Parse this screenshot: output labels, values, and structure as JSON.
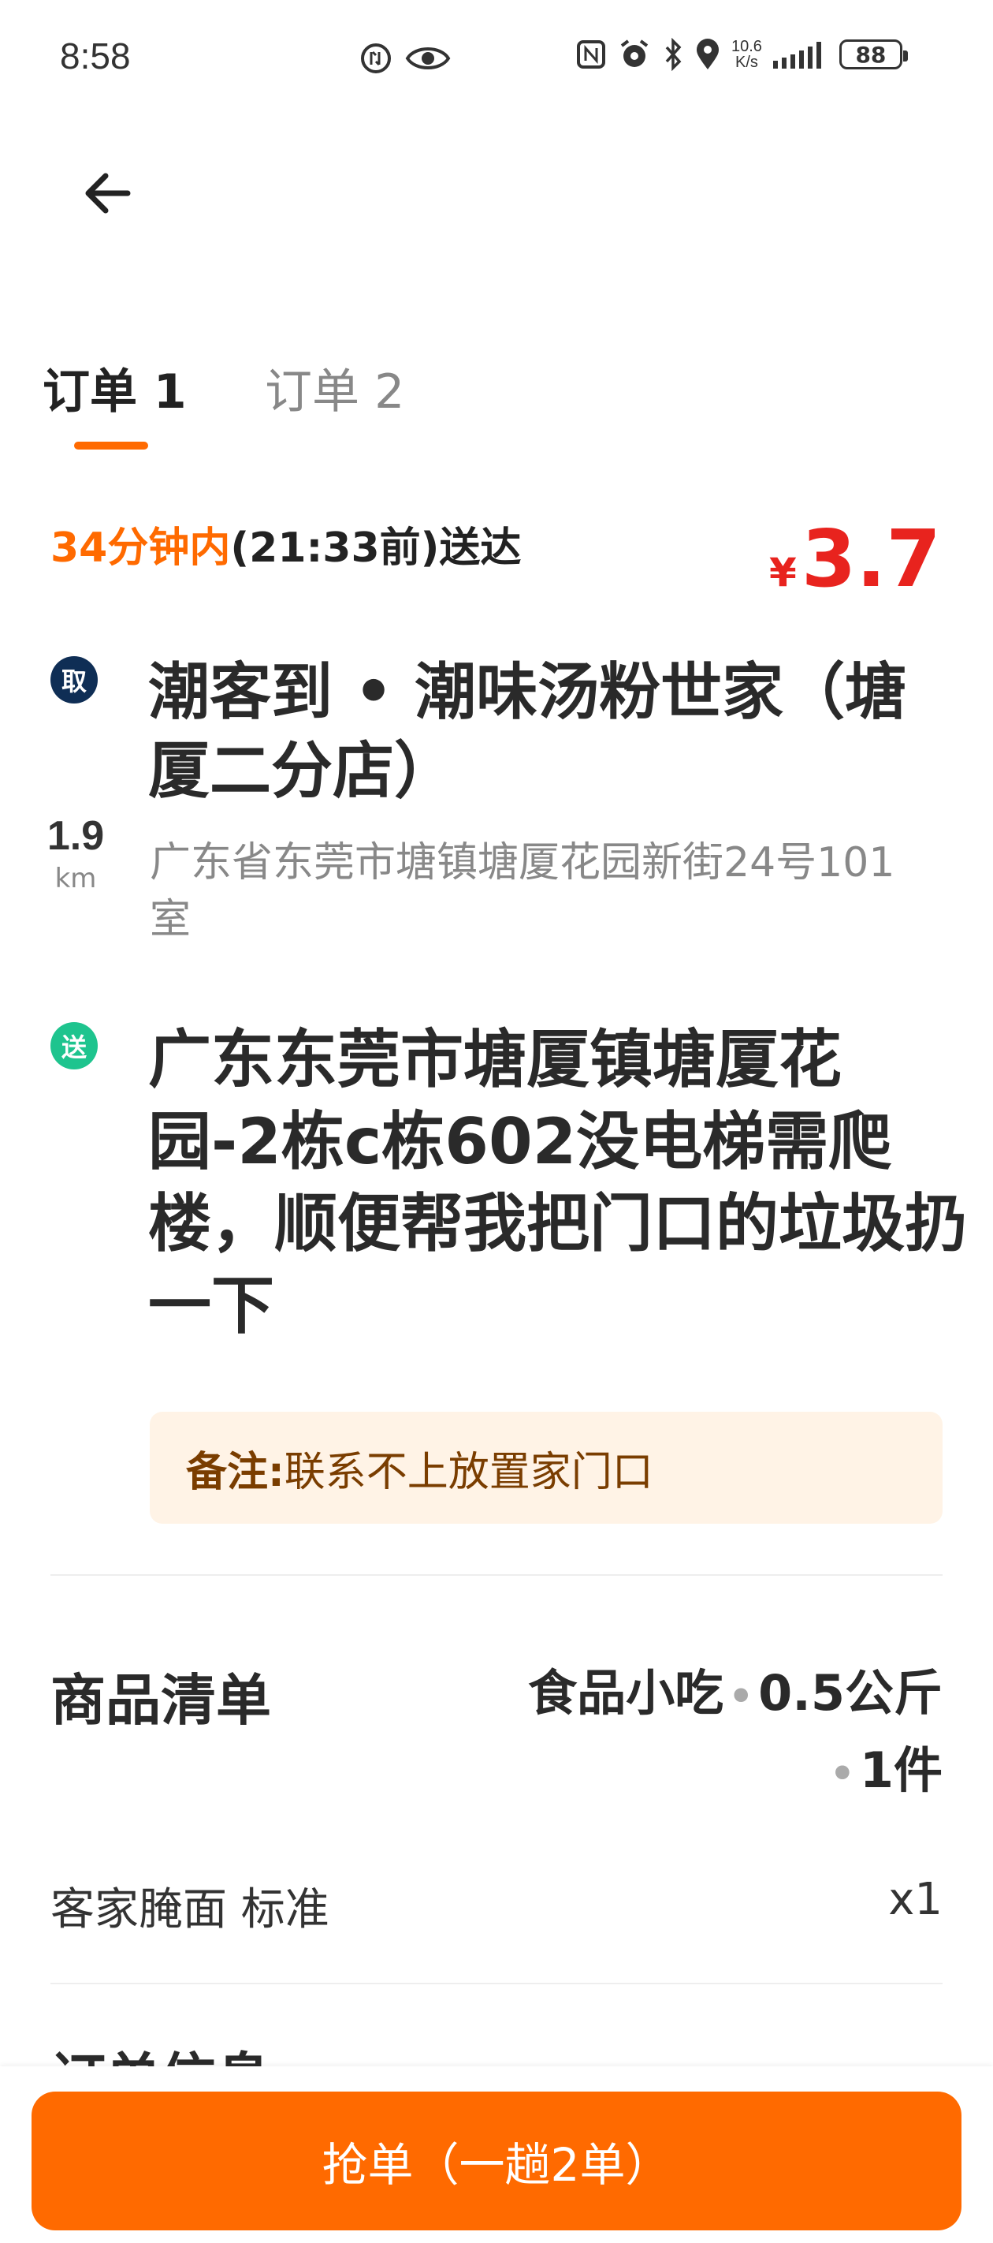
{
  "status_bar": {
    "time": "8:58",
    "net_speed_value": "10.6",
    "net_speed_unit": "K/s",
    "battery": "88",
    "icons": [
      "data-saver-icon",
      "eye-icon",
      "nfc-icon",
      "alarm-icon",
      "bluetooth-icon",
      "location-icon",
      "signal-icon"
    ]
  },
  "header": {
    "back_icon": "arrow-left-icon"
  },
  "tabs": [
    {
      "label": "订单 1",
      "active": true
    },
    {
      "label": "订单 2",
      "active": false
    }
  ],
  "eta": {
    "highlight": "34分钟内",
    "rest": "(21:33前)送达"
  },
  "price": {
    "symbol": "¥",
    "value": "3.7"
  },
  "pickup": {
    "badge": "取",
    "distance": "1.9",
    "distance_unit": "km",
    "shop_name": "潮客到 • 潮味汤粉世家（塘厦二分店）",
    "address": "广东省东莞市塘镇塘厦花园新街24号101室"
  },
  "dropoff": {
    "badge": "送",
    "address": "广东东莞市塘厦镇塘厦花园-2栋c栋602没电梯需爬楼，顺便帮我把门口的垃圾扔一下"
  },
  "note": {
    "label": "备注:",
    "text": "联系不上放置家门口"
  },
  "goods": {
    "title": "商品清单",
    "category": "食品小吃",
    "weight": "0.5公斤",
    "count": "1件",
    "items": [
      {
        "name": "客家腌面 标准",
        "qty": "x1"
      }
    ]
  },
  "order_info": {
    "title": "订单信息"
  },
  "action": {
    "grab_label": "抢单（一趟2单）"
  },
  "colors": {
    "accent": "#ff6a00",
    "price": "#e8231e",
    "pickup_badge": "#0f2e55",
    "drop_badge": "#1ec48e"
  }
}
